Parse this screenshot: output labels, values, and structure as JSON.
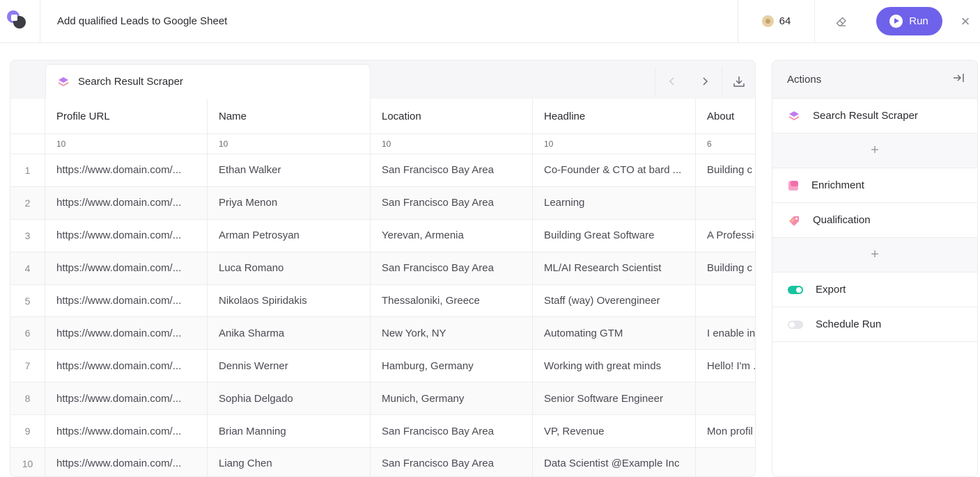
{
  "header": {
    "title": "Add qualified Leads to Google Sheet",
    "credits": "64",
    "run_label": "Run",
    "close_label": "×"
  },
  "table": {
    "tab_label": "Search Result Scraper",
    "columns": [
      "Profile URL",
      "Name",
      "Location",
      "Headline",
      "About"
    ],
    "counts": [
      "10",
      "10",
      "10",
      "10",
      "6"
    ],
    "rows": [
      {
        "n": "1",
        "url": "https://www.domain.com/...",
        "name": "Ethan Walker",
        "location": "San Francisco Bay Area",
        "headline": "Co-Founder & CTO at bard ...",
        "about": "Building c"
      },
      {
        "n": "2",
        "url": "https://www.domain.com/...",
        "name": "Priya Menon",
        "location": "San Francisco Bay Area",
        "headline": "Learning",
        "about": ""
      },
      {
        "n": "3",
        "url": "https://www.domain.com/...",
        "name": "Arman Petrosyan",
        "location": "Yerevan, Armenia",
        "headline": "Building Great Software",
        "about": "A Professi"
      },
      {
        "n": "4",
        "url": "https://www.domain.com/...",
        "name": "Luca Romano",
        "location": "San Francisco Bay Area",
        "headline": "ML/AI Research Scientist",
        "about": "Building c"
      },
      {
        "n": "5",
        "url": "https://www.domain.com/...",
        "name": "Nikolaos Spiridakis",
        "location": "Thessaloniki, Greece",
        "headline": "Staff (way) Overengineer",
        "about": ""
      },
      {
        "n": "6",
        "url": "https://www.domain.com/...",
        "name": "Anika Sharma",
        "location": "New York, NY",
        "headline": "Automating GTM",
        "about": "I enable in"
      },
      {
        "n": "7",
        "url": "https://www.domain.com/...",
        "name": "Dennis Werner",
        "location": "Hamburg, Germany",
        "headline": "Working with great minds",
        "about": "Hello! I'm ."
      },
      {
        "n": "8",
        "url": "https://www.domain.com/...",
        "name": "Sophia Delgado",
        "location": "Munich, Germany",
        "headline": "Senior Software Engineer",
        "about": ""
      },
      {
        "n": "9",
        "url": "https://www.domain.com/...",
        "name": "Brian Manning",
        "location": "San Francisco Bay Area",
        "headline": "VP, Revenue",
        "about": "Mon profil"
      },
      {
        "n": "10",
        "url": "https://www.domain.com/...",
        "name": "Liang Chen",
        "location": "San Francisco Bay Area",
        "headline": "Data Scientist @Example Inc",
        "about": ""
      }
    ]
  },
  "actions": {
    "title": "Actions",
    "items": {
      "scraper": "Search Result Scraper",
      "add1": "+",
      "enrichment": "Enrichment",
      "qualification": "Qualification",
      "add2": "+",
      "export": "Export",
      "schedule": "Schedule Run"
    },
    "export_enabled": true,
    "schedule_enabled": false
  },
  "colors": {
    "accent": "#6f62ea",
    "toggle_on": "#18c4a0"
  }
}
